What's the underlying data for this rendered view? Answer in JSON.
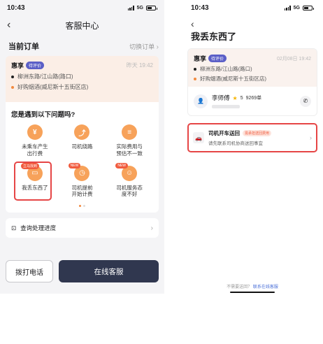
{
  "left": {
    "status": {
      "time": "10:43",
      "network": "5G"
    },
    "nav": {
      "title": "客服中心"
    },
    "orders": {
      "title": "当前订单",
      "switch": "切换订单"
    },
    "order": {
      "brand": "惠享",
      "status": "待评价",
      "time": "昨天 19:42",
      "from": "柳洲东路/江山路(路口)",
      "to": "好购烟酒(威尼斯十五街区店)",
      "colors": {
        "from": "#1f1f1f",
        "to": "#f28a3f"
      }
    },
    "issues": {
      "question": "您是遇到以下问题吗?",
      "items": [
        {
          "label": "未乘车产生出行费",
          "icon": "yen-icon"
        },
        {
          "label": "司机绕路",
          "icon": "route-icon"
        },
        {
          "label": "实际费用与预估不一致",
          "icon": "receipt-icon"
        },
        {
          "label": "我丢东西了",
          "icon": "wallet-icon",
          "badge": "立马找到"
        },
        {
          "label": "司机提前开始计费",
          "icon": "clock-icon",
          "badge": "NEW"
        },
        {
          "label": "司机服务态度不好",
          "icon": "driver-icon",
          "badge": "NEW"
        }
      ],
      "page_total": 2,
      "page_current": 1
    },
    "progress": {
      "label": "查询处理进度"
    },
    "buttons": {
      "call": "拨打电话",
      "online": "在线客服"
    }
  },
  "right": {
    "status": {
      "time": "10:43",
      "network": "5G"
    },
    "title": "我丢东西了",
    "order": {
      "brand": "惠享",
      "status": "待评价",
      "time": "02月08日 19:42",
      "from": "柳洲东路/江山路(路口)",
      "to": "好购烟酒(威尼斯十五街区店)"
    },
    "driver": {
      "name": "李师傅",
      "rating": "5",
      "orders": "9269单"
    },
    "notice": {
      "title": "司机开车送回",
      "tag": "需承担送回费用",
      "sub": "请先联系司机协商送回事宜"
    },
    "help": {
      "text": "不需要送回？",
      "link": "联系在线客服"
    }
  },
  "accent": {
    "orange": "#f28a3f",
    "red_highlight": "#e64545",
    "button_dark": "#30374f",
    "status_pill": "#5b5fc7"
  }
}
